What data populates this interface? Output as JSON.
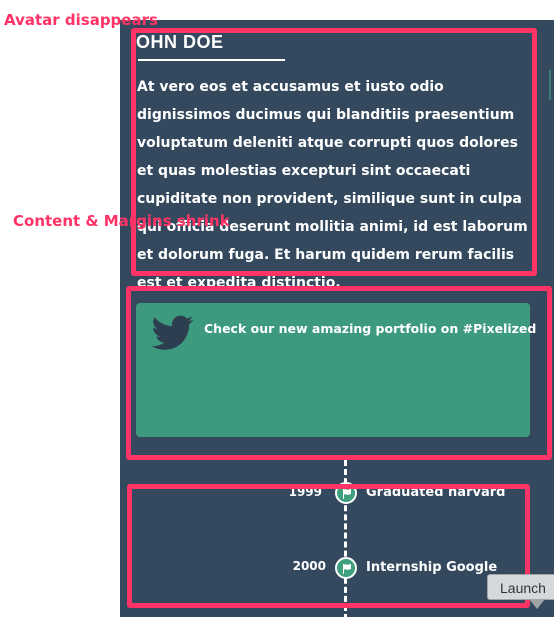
{
  "annotations": {
    "avatar": "Avatar disappears",
    "content": "Content & Margins shrink"
  },
  "profile": {
    "name": "OHN DOE",
    "bio": "At vero eos et accusamus et iusto odio dignissimos ducimus qui blanditiis praesentium voluptatum deleniti atque corrupti quos dolores et quas molestias excepturi sint occaecati cupiditate non provident, similique sunt in culpa qui officia deserunt mollitia animi, id est laborum et dolorum fuga. Et harum quidem rerum facilis est et expedita distinctio."
  },
  "tweet": {
    "icon": "twitter-bird-icon",
    "text": "Check our new amazing portfolio on #Pixelized"
  },
  "timeline": {
    "items": [
      {
        "year": "1999",
        "label": "Graduated harvard",
        "icon": "flag-icon"
      },
      {
        "year": "2000",
        "label": "Internship Google",
        "icon": "flag-icon"
      }
    ]
  },
  "launch_button": {
    "label": "Launch"
  },
  "colors": {
    "panel": "#34495e",
    "accent": "#3d9a7f",
    "highlight": "#ff3366"
  }
}
